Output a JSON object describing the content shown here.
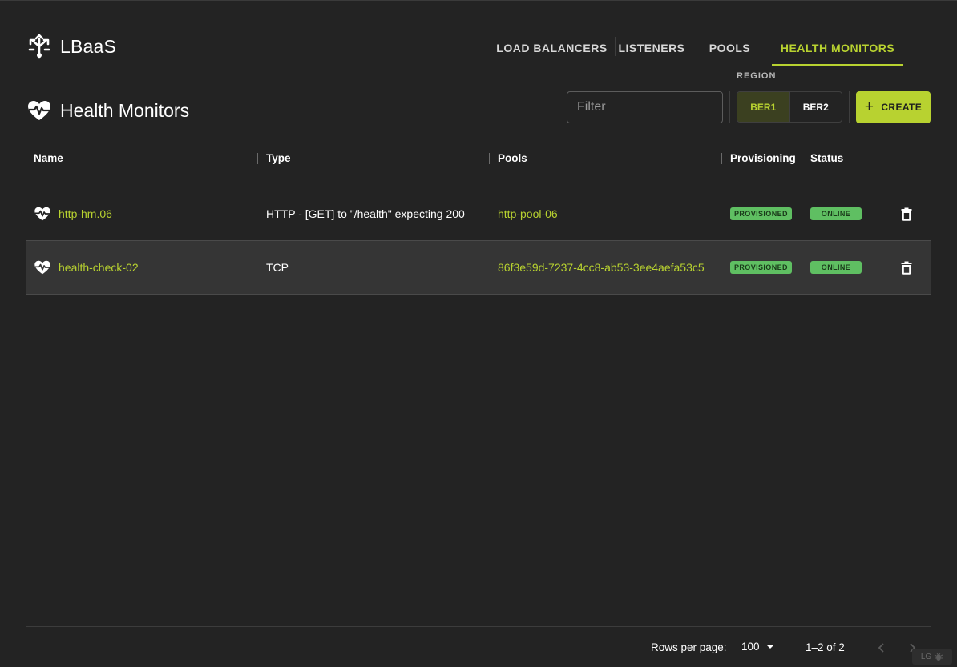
{
  "app": {
    "title": "LBaaS",
    "icon": "arrows-split-icon"
  },
  "nav": {
    "tabs": [
      {
        "label": "LOAD BALANCERS",
        "active": false
      },
      {
        "label": "LISTENERS",
        "active": false
      },
      {
        "label": "POOLS",
        "active": false
      },
      {
        "label": "HEALTH MONITORS",
        "active": true
      }
    ]
  },
  "page": {
    "title": "Health Monitors",
    "icon": "heart-pulse-icon"
  },
  "filter": {
    "placeholder": "Filter",
    "value": ""
  },
  "region": {
    "label": "REGION",
    "options": [
      "BER1",
      "BER2"
    ],
    "selected": "BER1"
  },
  "create_button": {
    "label": "CREATE",
    "icon": "plus-icon"
  },
  "table": {
    "columns": [
      "Name",
      "Type",
      "Pools",
      "Provisioning",
      "Status"
    ],
    "rows": [
      {
        "name": "http-hm.06",
        "type": "HTTP - [GET] to \"/health\" expecting 200",
        "pools": "http-pool-06",
        "provisioning": "PROVISIONED",
        "status": "ONLINE"
      },
      {
        "name": "health-check-02",
        "type": "TCP",
        "pools": "86f3e59d-7237-4cc8-ab53-3ee4aefa53c5",
        "provisioning": "PROVISIONED",
        "status": "ONLINE"
      }
    ]
  },
  "pagination": {
    "rows_per_page_label": "Rows per page:",
    "rows_per_page": "100",
    "range": "1–2 of 2"
  },
  "corner_badge": "LG",
  "colors": {
    "background": "#232323",
    "accent": "#b8d230",
    "badge_green": "#5fbf62",
    "row_alt": "#353535"
  }
}
